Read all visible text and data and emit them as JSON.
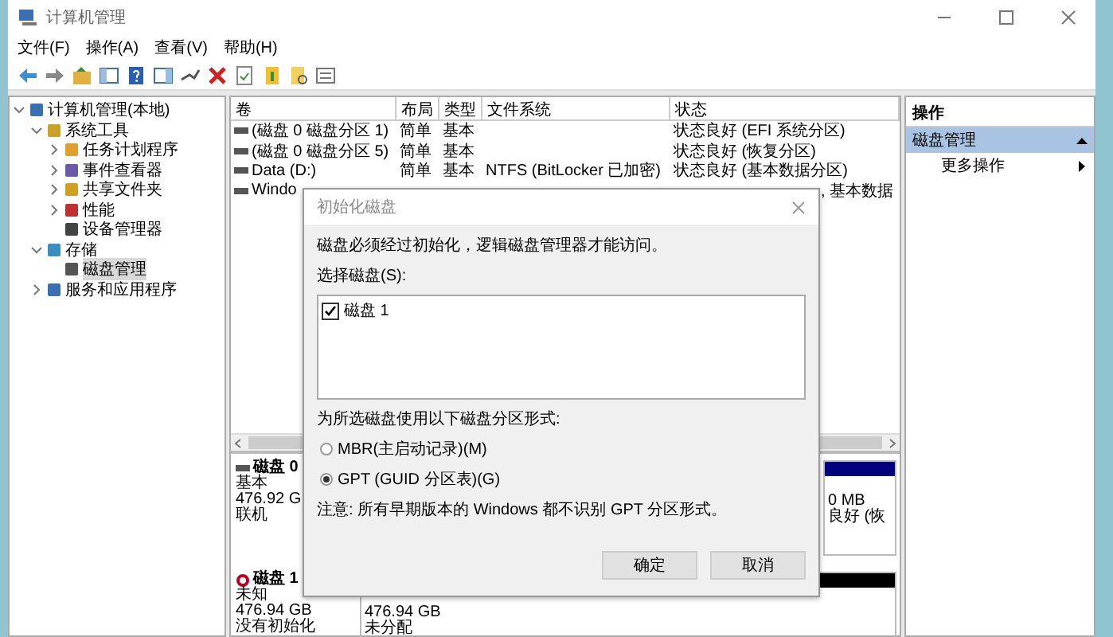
{
  "window": {
    "title": "计算机管理"
  },
  "menu": [
    "文件(F)",
    "操作(A)",
    "查看(V)",
    "帮助(H)"
  ],
  "tree": [
    {
      "label": "计算机管理(本地)",
      "selected": false,
      "expanded": true,
      "children": [
        {
          "label": "系统工具",
          "selected": false,
          "expanded": true,
          "children": [
            {
              "label": "任务计划程序",
              "selected": false,
              "expanded": false
            },
            {
              "label": "事件查看器",
              "selected": false,
              "expanded": false
            },
            {
              "label": "共享文件夹",
              "selected": false,
              "expanded": false
            },
            {
              "label": "性能",
              "selected": false,
              "expanded": false
            },
            {
              "label": "设备管理器",
              "selected": false
            }
          ]
        },
        {
          "label": "存储",
          "selected": false,
          "expanded": true,
          "children": [
            {
              "label": "磁盘管理",
              "selected": true
            }
          ]
        },
        {
          "label": "服务和应用程序",
          "selected": false,
          "expanded": false
        }
      ]
    }
  ],
  "table": {
    "columns": [
      "卷",
      "布局",
      "类型",
      "文件系统",
      "状态"
    ],
    "rows": [
      [
        "(磁盘 0 磁盘分区 1)",
        "简单",
        "基本",
        "",
        "状态良好 (EFI 系统分区)"
      ],
      [
        "(磁盘 0 磁盘分区 5)",
        "简单",
        "基本",
        "",
        "状态良好 (恢复分区)"
      ],
      [
        "Data (D:)",
        "简单",
        "基本",
        "NTFS (BitLocker 已加密)",
        "状态良好 (基本数据分区)"
      ],
      [
        "Windo",
        "",
        "",
        "",
        ", 基本数据"
      ]
    ]
  },
  "disks": [
    {
      "name": "磁盘 0",
      "kind": "online",
      "lines": [
        "基本",
        "476.92 G",
        "联机"
      ],
      "partition": {
        "color": "#00007f",
        "lines": [
          "0 MB",
          "良好 (恢"
        ]
      }
    },
    {
      "name": "磁盘 1",
      "kind": "uninitialized",
      "lines": [
        "未知",
        "476.94 GB",
        "没有初始化"
      ],
      "partition": {
        "color": "#000000",
        "lines": [
          "476.94 GB",
          "未分配"
        ]
      }
    }
  ],
  "actions": {
    "title": "操作",
    "items": [
      {
        "label": "磁盘管理",
        "kind": "section",
        "selected": true
      },
      {
        "label": "更多操作",
        "kind": "submenu",
        "selected": false
      }
    ]
  },
  "dialog": {
    "title": "初始化磁盘",
    "message": "磁盘必须经过初始化，逻辑磁盘管理器才能访问。",
    "select_label": "选择磁盘(S):",
    "disks": [
      {
        "label": "磁盘 1",
        "checked": true
      }
    ],
    "style_label": "为所选磁盘使用以下磁盘分区形式:",
    "options": [
      {
        "label": "MBR(主启动记录)(M)",
        "selected": false
      },
      {
        "label": "GPT (GUID 分区表)(G)",
        "selected": true
      }
    ],
    "note": "注意: 所有早期版本的 Windows 都不识别 GPT 分区形式。",
    "buttons": [
      "确定",
      "取消"
    ]
  }
}
